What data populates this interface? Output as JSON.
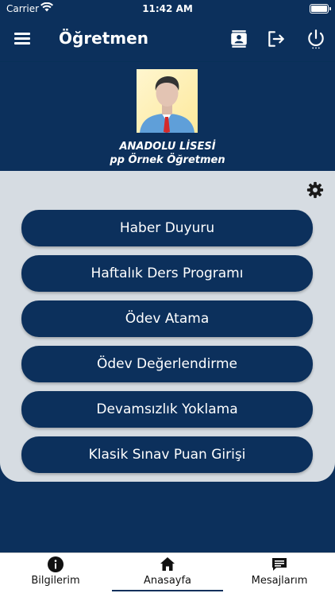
{
  "status_bar": {
    "carrier": "Carrier",
    "time": "11:42 AM"
  },
  "header": {
    "title": "Öğretmen",
    "icons": [
      "menu-icon",
      "contact-card-icon",
      "logout-icon",
      "power-icon"
    ]
  },
  "profile": {
    "school": "ANADOLU LİSESİ",
    "teacher": "pp Örnek Öğretmen"
  },
  "menu": {
    "items": [
      {
        "label": "Haber Duyuru"
      },
      {
        "label": "Haftalık Ders Programı"
      },
      {
        "label": "Ödev Atama"
      },
      {
        "label": "Ödev Değerlendirme"
      },
      {
        "label": "Devamsızlık Yoklama"
      },
      {
        "label": "Klasik Sınav Puan Girişi"
      }
    ]
  },
  "tabs": {
    "items": [
      {
        "label": "Bilgilerim",
        "icon": "info-icon"
      },
      {
        "label": "Anasayfa",
        "icon": "home-icon",
        "active": true
      },
      {
        "label": "Mesajlarım",
        "icon": "message-icon"
      }
    ]
  },
  "colors": {
    "primary": "#0c305c",
    "panel": "#d6dce2",
    "tabbar": "#ffffff"
  }
}
